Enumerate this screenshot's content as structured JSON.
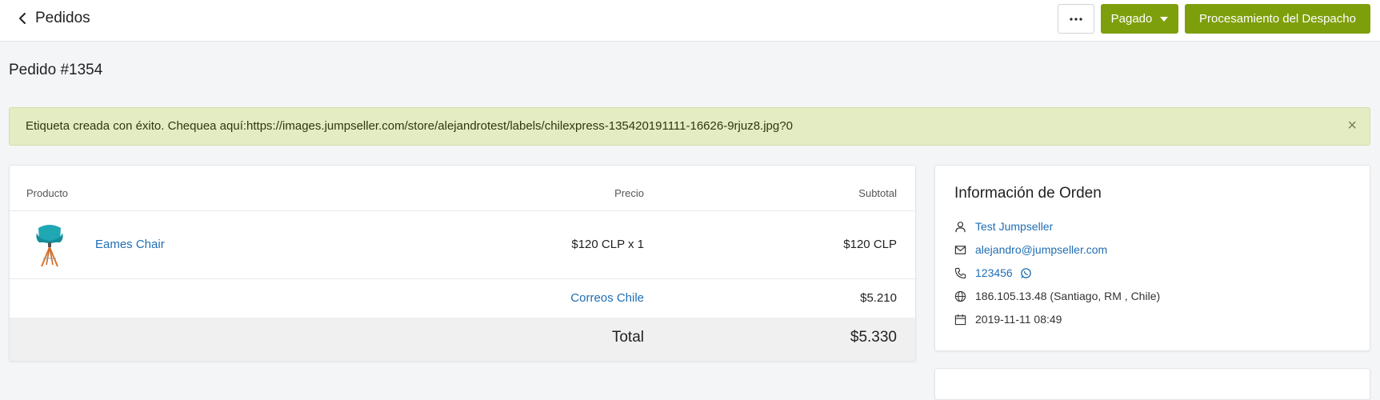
{
  "topbar": {
    "back_label": "Pedidos",
    "more_label": "···",
    "status_button": "Pagado",
    "process_button": "Procesamiento del Despacho"
  },
  "page": {
    "title": "Pedido #1354"
  },
  "alert": {
    "message": "Etiqueta creada con éxito. Chequea aquí:https://images.jumpseller.com/store/alejandrotest/labels/chilexpress-135420191111-16626-9rjuz8.jpg?0",
    "close": "×"
  },
  "products": {
    "headers": {
      "product": "Producto",
      "price": "Precio",
      "subtotal": "Subtotal"
    },
    "items": [
      {
        "name": "Eames Chair",
        "price": "$120 CLP x 1",
        "subtotal": "$120 CLP"
      }
    ],
    "shipping": {
      "label": "Correos Chile",
      "value": "$5.210"
    },
    "total": {
      "label": "Total",
      "value": "$5.330"
    }
  },
  "info": {
    "title": "Información de Orden",
    "customer": "Test Jumpseller",
    "email": "alejandro@jumpseller.com",
    "phone": "123456",
    "ip": "186.105.13.48 (Santiago, RM , Chile)",
    "date": "2019-11-11 08:49"
  },
  "colors": {
    "primary_button": "#7e9f0c",
    "link": "#1f6eb5",
    "alert_bg": "#e4ecc4",
    "whatsapp": "#1f6eb5"
  },
  "icons": [
    "chevron-left-icon",
    "user-icon",
    "envelope-icon",
    "phone-icon",
    "whatsapp-icon",
    "globe-icon",
    "calendar-icon"
  ]
}
